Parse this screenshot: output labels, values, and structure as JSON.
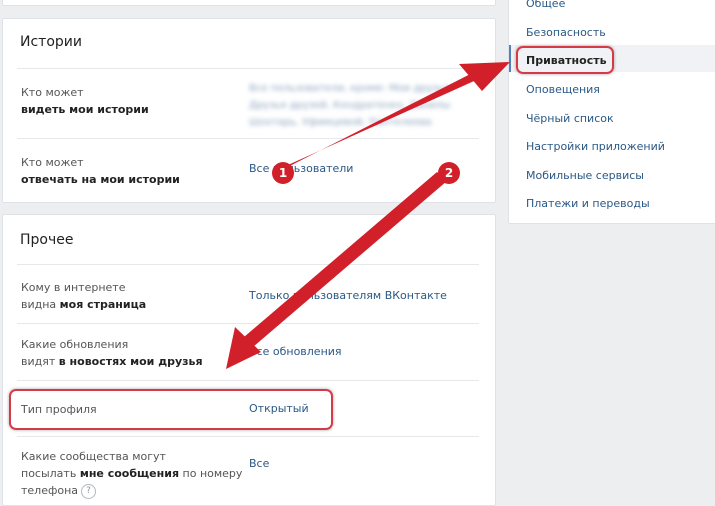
{
  "stories": {
    "title": "Истории",
    "rows": [
      {
        "label_1": "Кто может",
        "label_2": "видеть мои истории",
        "value": "Все пользователи, кроме: Мои друзья, Друзья друзей, Кондратенко, Данилы Шохтарь, Уфимцевой, Пантелеева"
      },
      {
        "label_1": "Кто может",
        "label_2": "отвечать на мои истории",
        "value": "Все пользователи"
      }
    ]
  },
  "other": {
    "title": "Прочее",
    "rows": [
      {
        "label_1": "Кому в интернете",
        "label_2a": "видна ",
        "label_2b": "моя страница",
        "value": "Только пользователям ВКонтакте"
      },
      {
        "label_1": "Какие обновления",
        "label_2a": "видят ",
        "label_2b": "в новостях мои друзья",
        "value": "Все обновления"
      },
      {
        "label_1": "Тип профиля",
        "value": "Открытый"
      },
      {
        "label_1": "Какие сообщества могут",
        "label_2a": "посылать ",
        "label_2b": "мне сообщения",
        "label_2c": " по номеру",
        "label_3": "телефона",
        "help": "?",
        "value": "Все"
      }
    ]
  },
  "menu": {
    "items": [
      "Общее",
      "Безопасность",
      "Приватность",
      "Оповещения",
      "Чёрный список",
      "Настройки приложений",
      "Мобильные сервисы",
      "Платежи и переводы"
    ],
    "active_index": 2
  },
  "annotations": {
    "badge_1": "1",
    "badge_2": "2",
    "accent_color": "#d2202b"
  }
}
